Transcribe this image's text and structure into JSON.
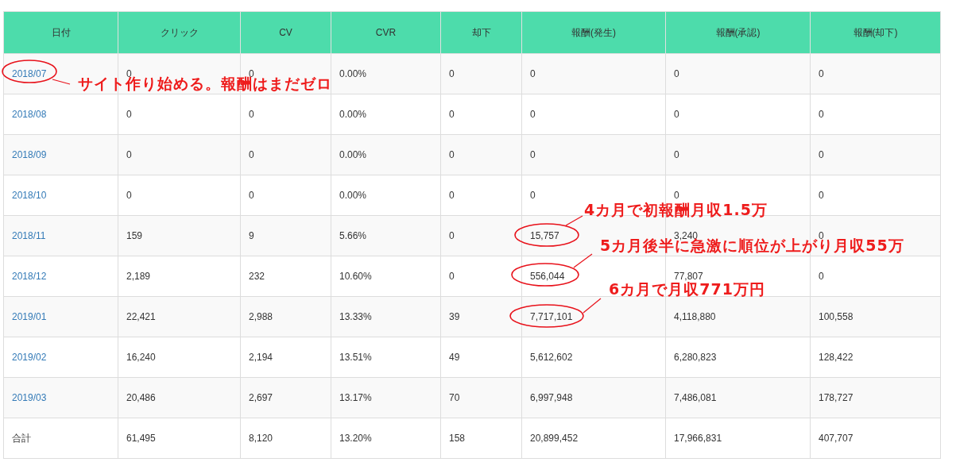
{
  "table": {
    "columns": [
      "日付",
      "クリック",
      "CV",
      "CVR",
      "却下",
      "報酬(発生)",
      "報酬(承認)",
      "報酬(却下)"
    ],
    "rows": [
      {
        "date": "2018/07",
        "values": [
          "0",
          "0",
          "0.00%",
          "0",
          "0",
          "0",
          "0"
        ]
      },
      {
        "date": "2018/08",
        "values": [
          "0",
          "0",
          "0.00%",
          "0",
          "0",
          "0",
          "0"
        ]
      },
      {
        "date": "2018/09",
        "values": [
          "0",
          "0",
          "0.00%",
          "0",
          "0",
          "0",
          "0"
        ]
      },
      {
        "date": "2018/10",
        "values": [
          "0",
          "0",
          "0.00%",
          "0",
          "0",
          "0",
          "0"
        ]
      },
      {
        "date": "2018/11",
        "values": [
          "159",
          "9",
          "5.66%",
          "0",
          "15,757",
          "3,240",
          "0"
        ]
      },
      {
        "date": "2018/12",
        "values": [
          "2,189",
          "232",
          "10.60%",
          "0",
          "556,044",
          "77,807",
          "0"
        ]
      },
      {
        "date": "2019/01",
        "values": [
          "22,421",
          "2,988",
          "13.33%",
          "39",
          "7,717,101",
          "4,118,880",
          "100,558"
        ]
      },
      {
        "date": "2019/02",
        "values": [
          "16,240",
          "2,194",
          "13.51%",
          "49",
          "5,612,602",
          "6,280,823",
          "128,422"
        ]
      },
      {
        "date": "2019/03",
        "values": [
          "20,486",
          "2,697",
          "13.17%",
          "70",
          "6,997,948",
          "7,486,081",
          "178,727"
        ]
      }
    ],
    "total": {
      "label": "合計",
      "values": [
        "61,495",
        "8,120",
        "13.20%",
        "158",
        "20,899,452",
        "17,966,831",
        "407,707"
      ]
    }
  },
  "annotations": [
    {
      "text": "サイト作り始める。報酬はまだゼロ"
    },
    {
      "text": "4カ月で初報酬月収1.5万"
    },
    {
      "text": "5カ月後半に急激に順位が上がり月収55万"
    },
    {
      "text": "6カ月で月収771万円"
    }
  ]
}
